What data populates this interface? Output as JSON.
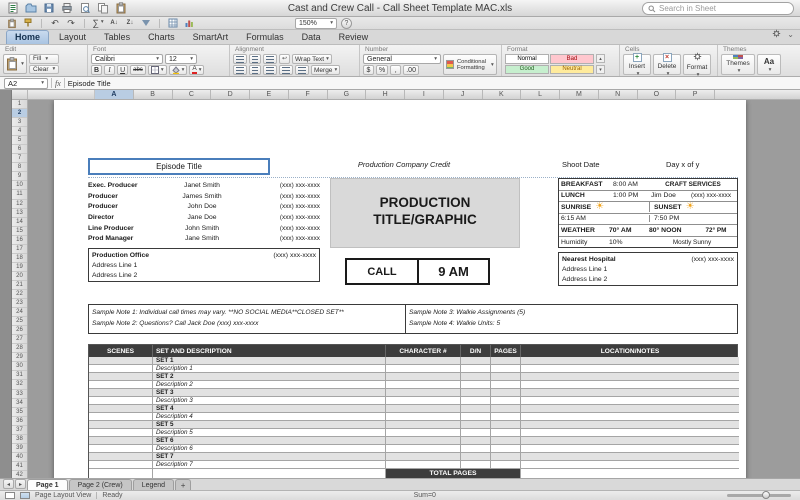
{
  "titlebar": {
    "title": "Cast and Crew Call - Call Sheet Template MAC.xls",
    "search_placeholder": "Search in Sheet"
  },
  "toolbar": {
    "zoom_value": "150%"
  },
  "icons": {
    "autosum": "∑",
    "undo": "↶",
    "redo": "↷",
    "sort_az": "A↓",
    "sort_za": "Z↓",
    "wrap": "↩",
    "help": "?",
    "collapse": "⌄",
    "sun": "☀",
    "tab_prev": "◂",
    "tab_next": "▸",
    "add_sheet": "+",
    "insert_plus": "+",
    "delete_x": "×",
    "aa": "Aa"
  },
  "ribbon": {
    "tabs": [
      {
        "label": "Home",
        "active": true
      },
      {
        "label": "Layout",
        "active": false
      },
      {
        "label": "Tables",
        "active": false
      },
      {
        "label": "Charts",
        "active": false
      },
      {
        "label": "SmartArt",
        "active": false
      },
      {
        "label": "Formulas",
        "active": false
      },
      {
        "label": "Data",
        "active": false
      },
      {
        "label": "Review",
        "active": false
      }
    ],
    "groups": {
      "edit": {
        "label": "Edit",
        "fill": "Fill",
        "clear": "Clear"
      },
      "font": {
        "label": "Font",
        "family": "Calibri",
        "size": "12",
        "bold": "B",
        "italic": "I",
        "underline": "U",
        "strike": "abc"
      },
      "alignment": {
        "label": "Alignment",
        "wrap": "Wrap Text",
        "merge": "Merge"
      },
      "number": {
        "label": "Number",
        "format": "General",
        "currency": "$",
        "percent": "%",
        "comma": ",",
        "decimal": ".00",
        "conditional_line1": "Conditional",
        "conditional_line2": "Formatting"
      },
      "format": {
        "label": "Format",
        "styles": [
          {
            "name": "Normal",
            "bg": "#ffffff",
            "fg": "#000000"
          },
          {
            "name": "Bad",
            "bg": "#ffc7ce",
            "fg": "#9c0006"
          },
          {
            "name": "Good",
            "bg": "#c6efce",
            "fg": "#276221"
          },
          {
            "name": "Neutral",
            "bg": "#ffeb9c",
            "fg": "#9c6500"
          }
        ]
      },
      "cells": {
        "label": "Cells",
        "insert": "Insert",
        "delete": "Delete",
        "format": "Format"
      },
      "themes": {
        "label": "Themes",
        "themes": "Themes",
        "aa": "Aa"
      }
    }
  },
  "formula_bar": {
    "cell_ref": "A2",
    "fx": "fx",
    "value": "Episode Title"
  },
  "grid": {
    "columns": [
      "A",
      "B",
      "C",
      "D",
      "E",
      "F",
      "G",
      "H",
      "I",
      "J",
      "K",
      "L",
      "M",
      "N",
      "O",
      "P"
    ],
    "selected_column": "A",
    "rows": [
      1,
      2,
      3,
      4,
      5,
      6,
      7,
      8,
      9,
      10,
      11,
      12,
      13,
      14,
      15,
      16,
      17,
      18,
      19,
      20,
      21,
      22,
      23,
      24,
      25,
      26,
      27,
      28,
      29,
      30,
      31,
      32,
      33,
      34,
      35,
      36,
      37,
      38,
      39,
      40,
      41,
      42
    ],
    "selected_row": 2
  },
  "sheet": {
    "episode_title": "Episode Title",
    "company_credit": "Production Company Credit",
    "shoot_date": "Shoot Date",
    "day_x_of_y": "Day x of y",
    "crew": [
      {
        "role": "Exec. Producer",
        "name": "Janet Smith",
        "phone": "(xxx) xxx-xxxx"
      },
      {
        "role": "Producer",
        "name": "James Smith",
        "phone": "(xxx) xxx-xxxx"
      },
      {
        "role": "Producer",
        "name": "John Doe",
        "phone": "(xxx) xxx-xxxx"
      },
      {
        "role": "Director",
        "name": "Jane Doe",
        "phone": "(xxx) xxx-xxxx"
      },
      {
        "role": "Line Producer",
        "name": "John Smith",
        "phone": "(xxx) xxx-xxxx"
      },
      {
        "role": "Prod Manager",
        "name": "Jane Smith",
        "phone": "(xxx) xxx-xxxx"
      }
    ],
    "production_office": {
      "label": "Production Office",
      "phone": "(xxx) xxx-xxxx",
      "address1": "Address Line 1",
      "address2": "Address Line 2"
    },
    "production_title": "PRODUCTION TITLE/GRAPHIC",
    "call": {
      "label": "CALL",
      "time": "9 AM"
    },
    "schedule": {
      "breakfast_label": "BREAKFAST",
      "breakfast_time": "8:00 AM",
      "craft_services": "CRAFT SERVICES",
      "lunch_label": "LUNCH",
      "lunch_time": "1:00 PM",
      "lunch_contact": "Jim Doe",
      "lunch_phone": "(xxx) xxx-xxxx",
      "sunrise_label": "SUNRISE",
      "sunrise_time": "6:15 AM",
      "sunset_label": "SUNSET",
      "sunset_time": "7:50 PM",
      "weather_label": "WEATHER",
      "weather_am": "70° AM",
      "weather_noon": "80° NOON",
      "weather_pm": "72° PM",
      "humidity_label": "Humidity",
      "humidity_value": "10%",
      "sky": "Mostly Sunny"
    },
    "hospital": {
      "label": "Nearest Hospital",
      "phone": "(xxx) xxx-xxxx",
      "address1": "Address Line 1",
      "address2": "Address Line 2"
    },
    "notes": [
      "Sample Note 1: Individual call times may vary.  **NO SOCIAL MEDIA**CLOSED SET**",
      "Sample Note 2: Questions?  Call Jack Doe (xxx) xxx-xxxx",
      "Sample Note 3: Walkie Assignments (5)",
      "Sample Note 4: Walkie Units: 5"
    ],
    "table": {
      "headers": [
        "SCENES",
        "SET AND DESCRIPTION",
        "CHARACTER #",
        "D/N",
        "PAGES",
        "LOCATION/NOTES"
      ],
      "rows": [
        {
          "set": "SET 1",
          "description": "Description 1"
        },
        {
          "set": "SET 2",
          "description": "Description 2"
        },
        {
          "set": "SET 3",
          "description": "Description 3"
        },
        {
          "set": "SET 4",
          "description": "Description 4"
        },
        {
          "set": "SET 5",
          "description": "Description 5"
        },
        {
          "set": "SET 6",
          "description": "Description 6"
        },
        {
          "set": "SET 7",
          "description": "Description 7"
        }
      ],
      "total_label": "TOTAL PAGES"
    }
  },
  "sheet_tabs": {
    "tabs": [
      {
        "label": "Page 1",
        "active": true
      },
      {
        "label": "Page 2 (Crew)",
        "active": false
      },
      {
        "label": "Legend",
        "active": false
      }
    ]
  },
  "status_bar": {
    "view": "Page Layout View",
    "ready": "Ready",
    "sum": "Sum=0"
  }
}
